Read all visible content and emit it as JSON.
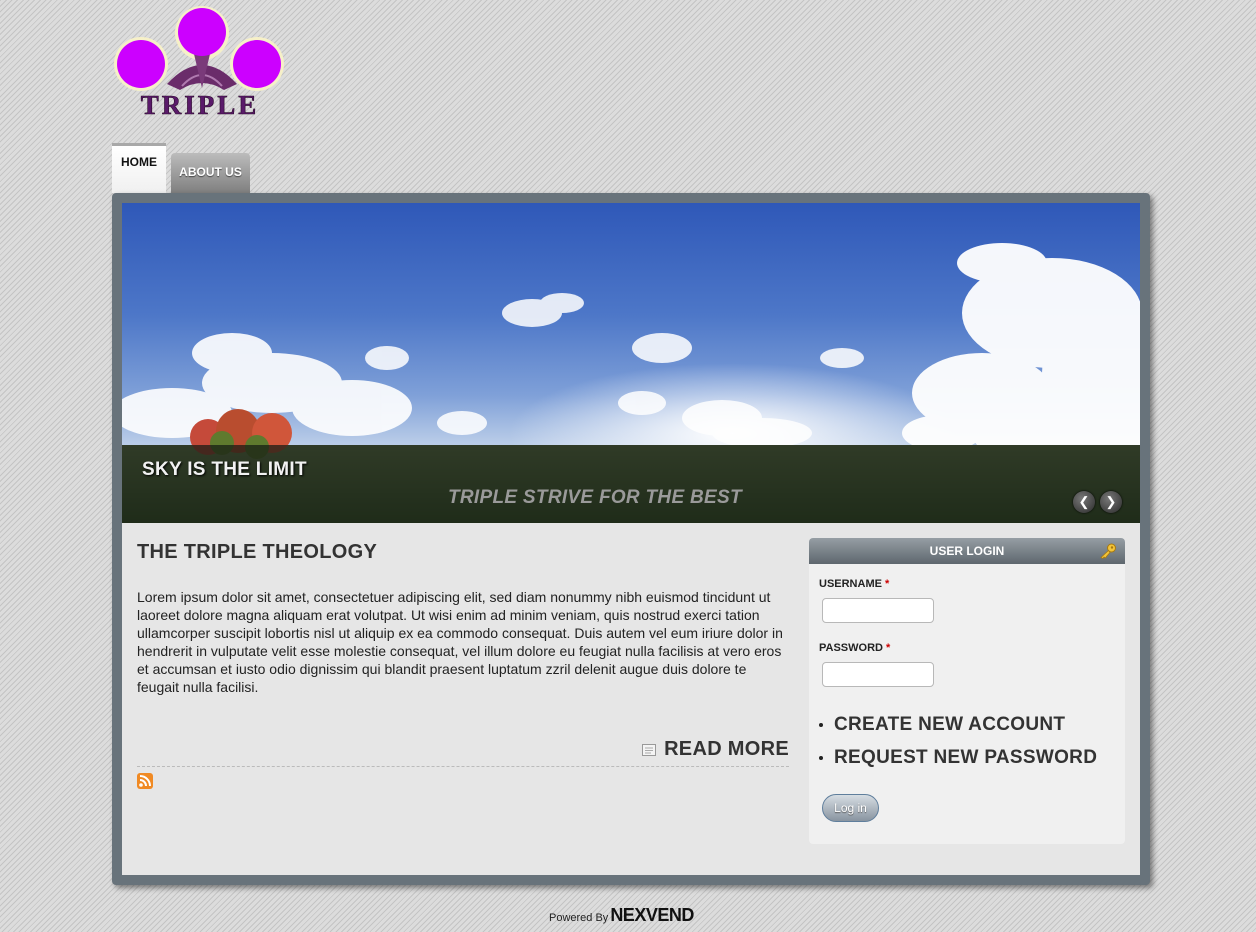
{
  "nav": {
    "home_label": "HOME",
    "about_label": "ABOUT US"
  },
  "slideshow": {
    "title": "SKY IS THE LIMIT",
    "subtitle": "TRIPLE STRIVE FOR THE BEST",
    "prev_icon": "chevron-left-icon",
    "next_icon": "chevron-right-icon",
    "prev_glyph": "❮",
    "next_glyph": "❯"
  },
  "article": {
    "title": "THE TRIPLE THEOLOGY",
    "body": "Lorem ipsum dolor sit amet, consectetuer adipiscing elit, sed diam nonummy nibh euismod tincidunt ut laoreet dolore magna aliquam erat volutpat. Ut wisi enim ad minim veniam, quis nostrud exerci tation ullamcorper suscipit lobortis nisl ut aliquip ex ea commodo consequat. Duis autem vel eum iriure dolor in hendrerit in vulputate velit esse molestie consequat, vel illum dolore eu feugiat nulla facilisis at vero eros et accumsan et iusto odio dignissim qui blandit praesent luptatum zzril delenit augue duis dolore te feugait nulla facilisi.",
    "read_more": "READ MORE"
  },
  "login": {
    "heading": "USER LOGIN",
    "username_label": "USERNAME",
    "password_label": "PASSWORD",
    "required_mark": "*",
    "username_value": "",
    "password_value": "",
    "create_account": "CREATE NEW ACCOUNT",
    "request_password": "REQUEST NEW PASSWORD",
    "submit_label": "Log in"
  },
  "footer": {
    "powered_by": "Powered By",
    "brand": "NEXVEND"
  },
  "logo": {
    "text": "TRIPLE"
  },
  "colors": {
    "logo_circle": "#cc00ff",
    "frame": "#68737b",
    "content_bg": "#e6e6e6",
    "accent_text": "#333333"
  }
}
